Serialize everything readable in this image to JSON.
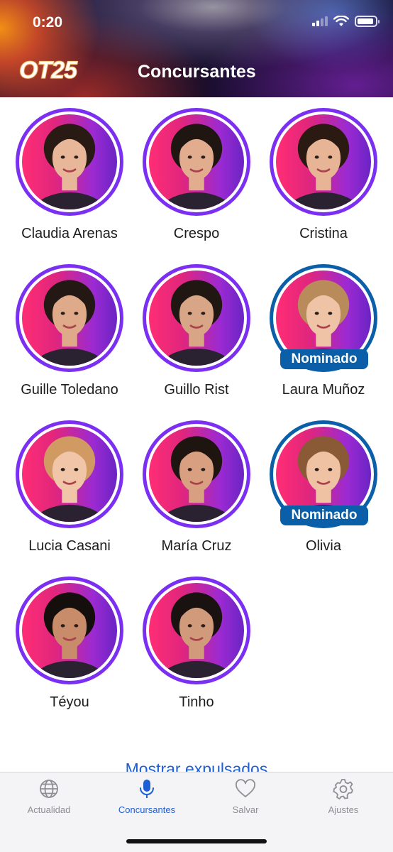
{
  "status": {
    "time": "0:20",
    "battery_level": 0.9
  },
  "header": {
    "logo": "OT25",
    "title": "Concursantes"
  },
  "contestants": [
    {
      "name": "Claudia Arenas",
      "nominated": false,
      "hair": "#2a1a14",
      "skin": "#e8b79a"
    },
    {
      "name": "Crespo",
      "nominated": false,
      "hair": "#1f1612",
      "skin": "#e2ad8f"
    },
    {
      "name": "Cristina",
      "nominated": false,
      "hair": "#2b1a12",
      "skin": "#e7b496"
    },
    {
      "name": "Guille Toledano",
      "nominated": false,
      "hair": "#231814",
      "skin": "#deaa8a"
    },
    {
      "name": "Guillo Rist",
      "nominated": false,
      "hair": "#201612",
      "skin": "#d9a587"
    },
    {
      "name": "Laura Muñoz",
      "nominated": true,
      "hair": "#b98b5a",
      "skin": "#efc3a6"
    },
    {
      "name": "Lucia Casani",
      "nominated": false,
      "hair": "#d19a63",
      "skin": "#f0c5a8"
    },
    {
      "name": "María Cruz",
      "nominated": false,
      "hair": "#1e1410",
      "skin": "#d8a080"
    },
    {
      "name": "Olivia",
      "nominated": true,
      "hair": "#8a5a36",
      "skin": "#efc2a3"
    },
    {
      "name": "Téyou",
      "nominated": false,
      "hair": "#140e0c",
      "skin": "#c98c6a"
    },
    {
      "name": "Tinho",
      "nominated": false,
      "hair": "#1a1210",
      "skin": "#d09a7b"
    }
  ],
  "nominated_label": "Nominado",
  "show_expelled_label": "Mostrar expulsados",
  "tabs": [
    {
      "id": "actualidad",
      "label": "Actualidad",
      "icon": "globe-icon",
      "active": false
    },
    {
      "id": "concursantes",
      "label": "Concursantes",
      "icon": "microphone-icon",
      "active": true
    },
    {
      "id": "salvar",
      "label": "Salvar",
      "icon": "heart-icon",
      "active": false
    },
    {
      "id": "ajustes",
      "label": "Ajustes",
      "icon": "gear-icon",
      "active": false
    }
  ],
  "colors": {
    "accent": "#1f5fd6",
    "ring": "#7b2ff2",
    "nominated": "#0a5fa8",
    "inactive": "#8e8e93"
  }
}
